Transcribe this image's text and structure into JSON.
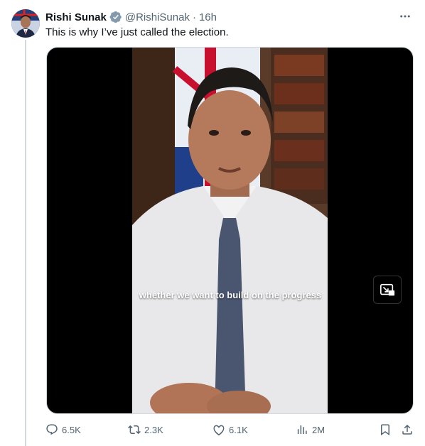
{
  "tweet": {
    "author_name": "Rishi Sunak",
    "handle": "@RishiSunak",
    "separator": "·",
    "time": "16h",
    "text": "This is why I’ve just called the election.",
    "video_caption": "whether we want to build on the progress"
  },
  "actions": {
    "replies": "6.5K",
    "reposts": "2.3K",
    "likes": "6.1K",
    "views": "2M"
  },
  "icons": {
    "verified": "verified-badge-icon",
    "more": "more-icon",
    "reply": "reply-icon",
    "repost": "repost-icon",
    "like": "heart-icon",
    "views": "views-icon",
    "bookmark": "bookmark-icon",
    "share": "share-icon",
    "pip": "picture-in-picture-icon"
  },
  "colors": {
    "text": "#0f1419",
    "secondary": "#536471",
    "verified": "#829aab",
    "line": "#cfd9de"
  }
}
